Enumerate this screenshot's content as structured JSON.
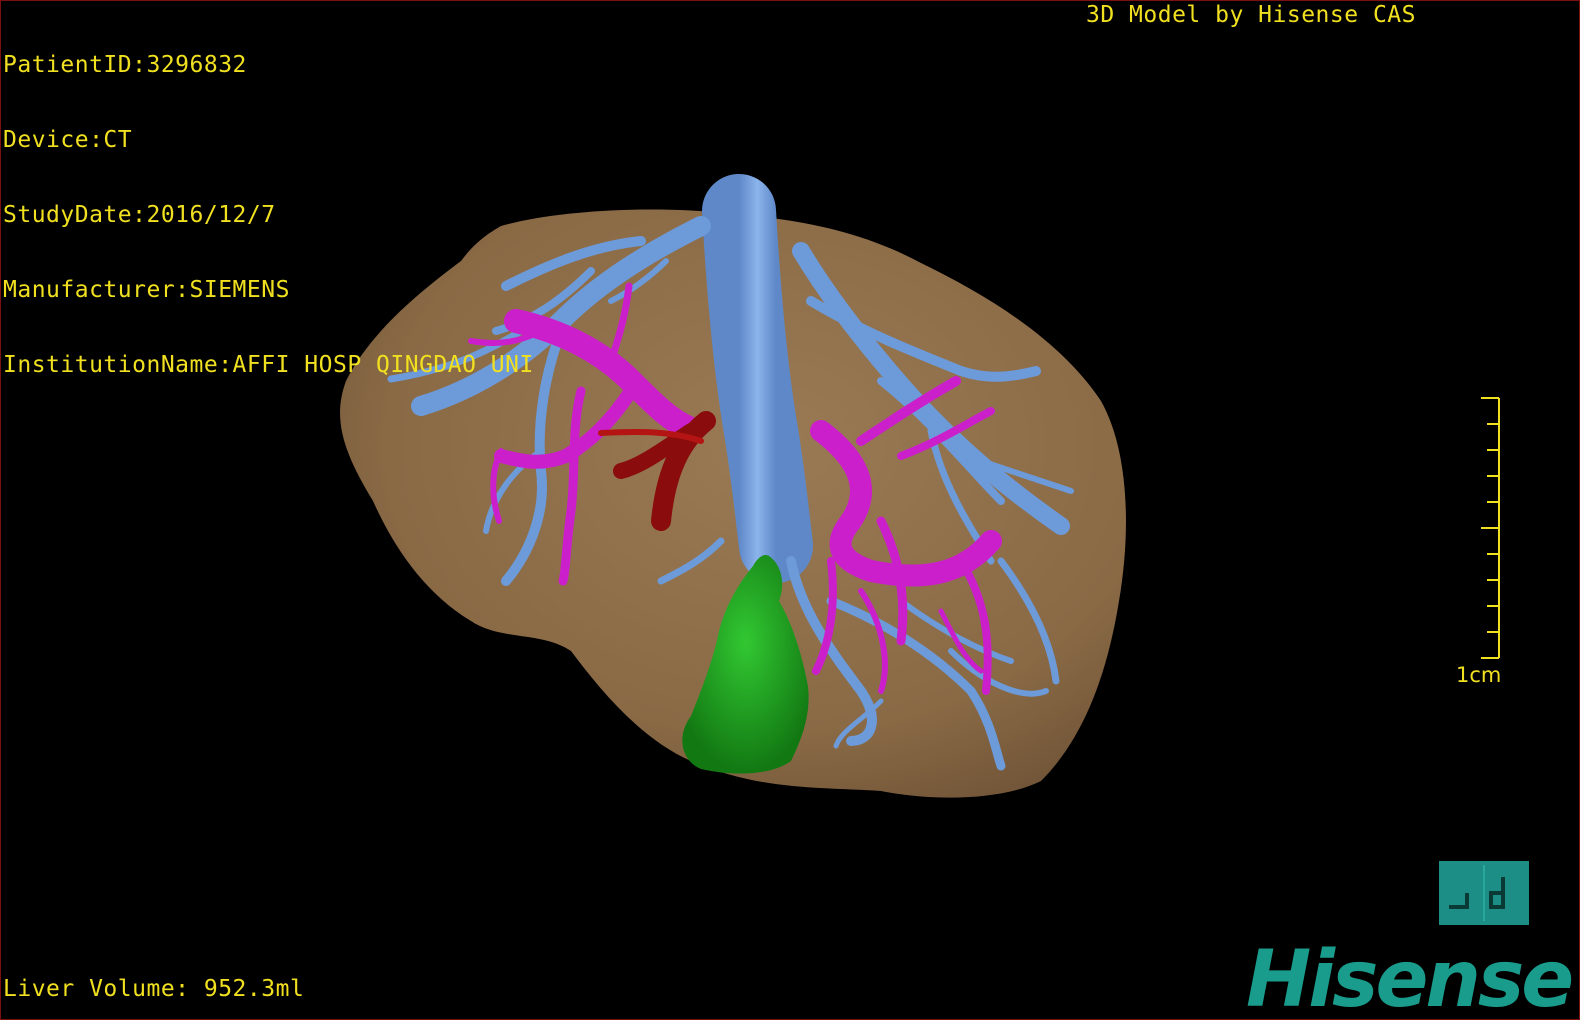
{
  "patient_info": {
    "patient_id": "PatientID:3296832",
    "device": "Device:CT",
    "study_date": "StudyDate:2016/12/7",
    "manufacturer": "Manufacturer:SIEMENS",
    "institution": "InstitutionName:AFFI HOSP QINGDAO UNI"
  },
  "credit": "3D Model by Hisense CAS",
  "liver_volume": "Liver Volume: 952.3ml",
  "scale_bar": {
    "label": "1cm"
  },
  "brand": "Hisense",
  "colors": {
    "overlay_text": "#f0e020",
    "liver": "#8e6c48",
    "hepatic_vein": "#6d9ad8",
    "portal_vein": "#cc1fcc",
    "aorta": "#8a0c0c",
    "lesion": "#1fa21f",
    "brand": "#1a9c8c"
  },
  "structures": [
    "liver",
    "hepatic-vein",
    "portal-vein",
    "aorta",
    "lesion"
  ]
}
